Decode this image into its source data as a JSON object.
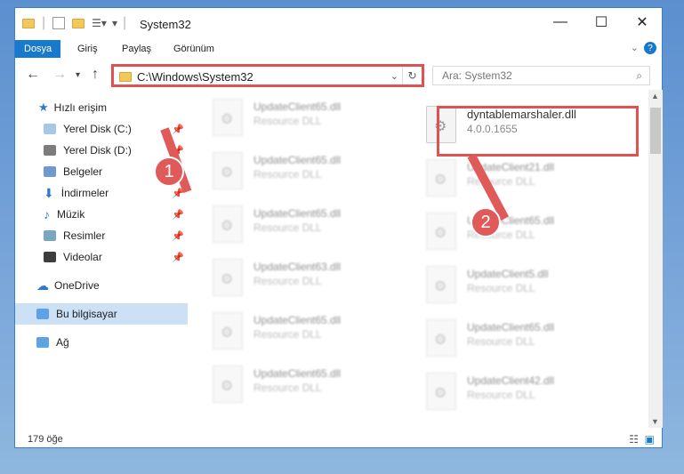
{
  "window": {
    "title": "System32"
  },
  "ribbon": {
    "tabs": [
      {
        "label": "Dosya"
      },
      {
        "label": "Giriş"
      },
      {
        "label": "Paylaş"
      },
      {
        "label": "Görünüm"
      }
    ]
  },
  "address": {
    "path": "C:\\Windows\\System32"
  },
  "search": {
    "placeholder": "Ara: System32"
  },
  "sidebar": {
    "items": [
      {
        "label": "Hızlı erişim"
      },
      {
        "label": "Yerel Disk (C:)"
      },
      {
        "label": "Yerel Disk (D:)"
      },
      {
        "label": "Belgeler"
      },
      {
        "label": "İndirmeler"
      },
      {
        "label": "Müzik"
      },
      {
        "label": "Resimler"
      },
      {
        "label": "Videolar"
      },
      {
        "label": "OneDrive"
      },
      {
        "label": "Bu bilgisayar"
      },
      {
        "label": "Ağ"
      }
    ]
  },
  "files": {
    "left": [
      {
        "name": "UpdateClient65.dll",
        "type": "Resource DLL"
      },
      {
        "name": "UpdateClient65.dll",
        "type": "Resource DLL"
      },
      {
        "name": "UpdateClient65.dll",
        "type": "Resource DLL"
      },
      {
        "name": "UpdateClient63.dll",
        "type": "Resource DLL"
      },
      {
        "name": "UpdateClient65.dll",
        "type": "Resource DLL"
      },
      {
        "name": "UpdateClient65.dll",
        "type": "Resource DLL"
      }
    ],
    "right": [
      {
        "name": "dyntablemarshaler.dll",
        "type": "4.0.0.1655"
      },
      {
        "name": "UpdateClient21.dll",
        "type": "Resource DLL"
      },
      {
        "name": "UpdateClient65.dll",
        "type": "Resource DLL"
      },
      {
        "name": "UpdateClient5.dll",
        "type": "Resource DLL"
      },
      {
        "name": "UpdateClient65.dll",
        "type": "Resource DLL"
      },
      {
        "name": "UpdateClient42.dll",
        "type": "Resource DLL"
      }
    ]
  },
  "status": {
    "count": "179 öğe"
  },
  "markers": {
    "one": "1",
    "two": "2"
  },
  "colors": {
    "accent": "#1979ca",
    "highlight": "#e05151"
  }
}
